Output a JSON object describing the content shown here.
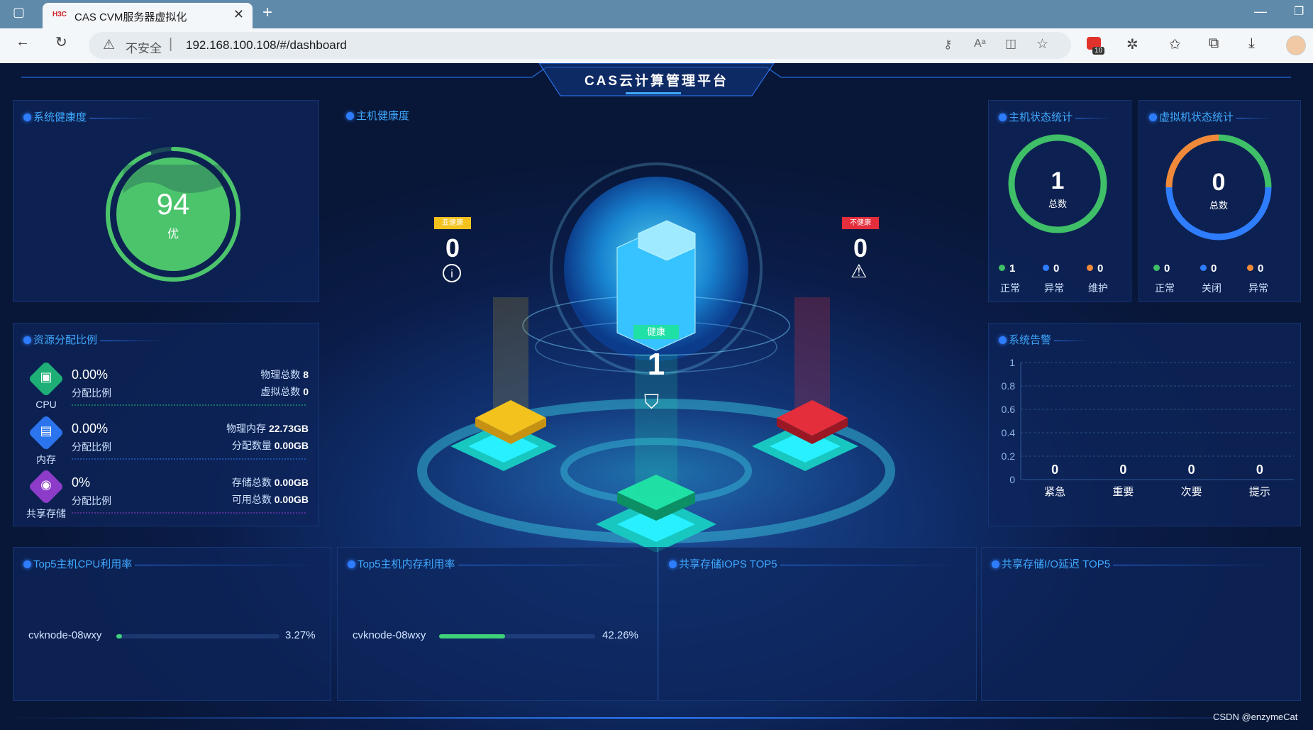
{
  "browser": {
    "tab_title": "CAS CVM服务器虚拟化",
    "tab_favicon": "H3C",
    "security_label": "不安全",
    "url": "192.168.100.108/#/dashboard",
    "extension_badge": "10"
  },
  "header": {
    "title": "CAS云计算管理平台"
  },
  "system_health": {
    "title": "系统健康度",
    "score": "94",
    "grade": "优",
    "score_fraction": 0.94,
    "color": "#4cc46c"
  },
  "host_health": {
    "title": "主机健康度",
    "sub_health": {
      "badge": "亚健康",
      "count": "0",
      "color": "#f3c21d"
    },
    "healthy": {
      "badge": "健康",
      "count": "1",
      "color": "#1fe0a5"
    },
    "unhealthy": {
      "badge": "不健康",
      "count": "0",
      "color": "#e52e3c"
    }
  },
  "host_status": {
    "title": "主机状态统计",
    "total": "1",
    "total_label": "总数",
    "items": [
      {
        "value": "1",
        "label": "正常",
        "color": "#3fbf68"
      },
      {
        "value": "0",
        "label": "异常",
        "color": "#2f7dff"
      },
      {
        "value": "0",
        "label": "维护",
        "color": "#f08a3a"
      }
    ]
  },
  "vm_status": {
    "title": "虚拟机状态统计",
    "total": "0",
    "total_label": "总数",
    "items": [
      {
        "value": "0",
        "label": "正常",
        "color": "#3fbf68"
      },
      {
        "value": "0",
        "label": "关闭",
        "color": "#2f7dff"
      },
      {
        "value": "0",
        "label": "异常",
        "color": "#f08a3a"
      }
    ]
  },
  "resource_alloc": {
    "title": "资源分配比例",
    "rows": [
      {
        "name": "CPU",
        "percent": "0.00%",
        "ratio_label": "分配比例",
        "k1": "物理总数",
        "v1": "8",
        "k2": "虚拟总数",
        "v2": "0",
        "color": "#1fbf7a"
      },
      {
        "name": "内存",
        "percent": "0.00%",
        "ratio_label": "分配比例",
        "k1": "物理内存",
        "v1": "22.73GB",
        "k2": "分配数量",
        "v2": "0.00GB",
        "color": "#2f7dff"
      },
      {
        "name": "共享存储",
        "percent": "0%",
        "ratio_label": "分配比例",
        "k1": "存储总数",
        "v1": "0.00GB",
        "k2": "可用总数",
        "v2": "0.00GB",
        "color": "#9a3fd6"
      }
    ]
  },
  "alerts": {
    "title": "系统告警",
    "chart_data": {
      "type": "bar",
      "categories": [
        "紧急",
        "重要",
        "次要",
        "提示"
      ],
      "values": [
        0,
        0,
        0,
        0
      ],
      "y_ticks": [
        "0",
        "0.2",
        "0.4",
        "0.6",
        "0.8",
        "1"
      ],
      "ylim": [
        0,
        1
      ],
      "value_labels": [
        "0",
        "0",
        "0",
        "0"
      ]
    }
  },
  "top5_cpu": {
    "title": "Top5主机CPU利用率",
    "rows": [
      {
        "host": "cvknode-08wxy",
        "value": "3.27%",
        "fraction": 0.0327
      }
    ]
  },
  "top5_mem": {
    "title": "Top5主机内存利用率",
    "rows": [
      {
        "host": "cvknode-08wxy",
        "value": "42.26%",
        "fraction": 0.4226
      }
    ]
  },
  "storage_iops": {
    "title": "共享存储IOPS TOP5"
  },
  "storage_latency": {
    "title": "共享存储I/O延迟 TOP5"
  },
  "watermark": "CSDN @enzymeCat"
}
